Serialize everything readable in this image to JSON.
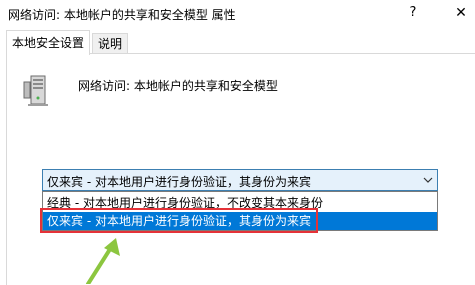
{
  "window": {
    "title": "网络访问: 本地帐户的共享和安全模型 属性",
    "help_glyph": "?",
    "close_glyph": "✕"
  },
  "tabs": [
    {
      "label": "本地安全设置",
      "active": true
    },
    {
      "label": "说明",
      "active": false
    }
  ],
  "policy": {
    "icon": "server-icon",
    "title": "网络访问: 本地帐户的共享和安全模型"
  },
  "dropdown": {
    "selected_value": "仅来宾 - 对本地用户进行身份验证，其身份为来宾",
    "options": [
      {
        "label": "经典 - 对本地用户进行身份验证，不改变其本来身份",
        "selected": false
      },
      {
        "label": "仅来宾 - 对本地用户进行身份验证，其身份为来宾",
        "selected": true
      }
    ]
  },
  "colors": {
    "highlight_border": "#e53238",
    "annotation_arrow": "#8cc63f",
    "selection": "#0078d7"
  }
}
